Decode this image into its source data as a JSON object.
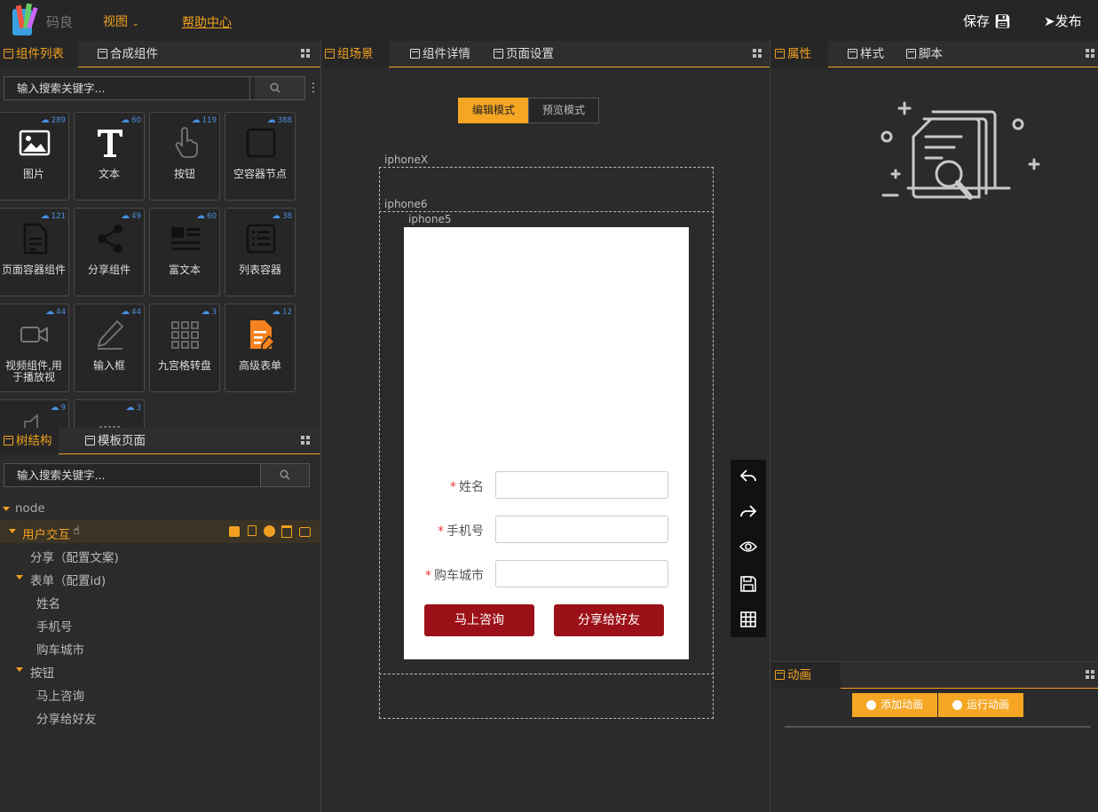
{
  "header": {
    "brand": "码良",
    "menu_view": "视图",
    "menu_help": "帮助中心",
    "save": "保存",
    "publish": "发布"
  },
  "components_panel": {
    "tabs": [
      "组件列表",
      "合成组件"
    ],
    "search_placeholder": "输入搜索关键字...",
    "cards": [
      {
        "label": "图片",
        "count": "289",
        "icon": "image-icon"
      },
      {
        "label": "文本",
        "count": "60",
        "icon": "text-icon"
      },
      {
        "label": "按钮",
        "count": "119",
        "icon": "tap-icon"
      },
      {
        "label": "空容器节点",
        "count": "388",
        "icon": "square-icon"
      },
      {
        "label": "页面容器组件",
        "count": "121",
        "icon": "document-icon"
      },
      {
        "label": "分享组件",
        "count": "49",
        "icon": "share-icon"
      },
      {
        "label": "富文本",
        "count": "60",
        "icon": "richtext-icon"
      },
      {
        "label": "列表容器",
        "count": "38",
        "icon": "list-icon"
      },
      {
        "label": "视频组件,用于播放视",
        "count": "44",
        "icon": "video-icon"
      },
      {
        "label": "输入框",
        "count": "44",
        "icon": "pen-icon"
      },
      {
        "label": "九宫格转盘",
        "count": "3",
        "icon": "grid-icon"
      },
      {
        "label": "高级表单",
        "count": "12",
        "icon": "form-icon"
      },
      {
        "label": "",
        "count": "9",
        "icon": "speaker-icon"
      },
      {
        "label": "",
        "count": "3",
        "icon": "misc-icon"
      }
    ]
  },
  "tree_panel": {
    "tabs": [
      "树结构",
      "模板页面"
    ],
    "search_placeholder": "输入搜索关键字...",
    "nodes": [
      {
        "label": "node",
        "level": 0,
        "caret": true
      },
      {
        "label": "用户交互",
        "level": 1,
        "caret": true,
        "selected": true
      },
      {
        "label": "分享（配置文案)",
        "level": 2,
        "caret": false
      },
      {
        "label": "表单（配置id)",
        "level": 2,
        "caret": true
      },
      {
        "label": "姓名",
        "level": 3,
        "caret": false
      },
      {
        "label": "手机号",
        "level": 3,
        "caret": false
      },
      {
        "label": "购车城市",
        "level": 3,
        "caret": false
      },
      {
        "label": "按钮",
        "level": 2,
        "caret": true
      },
      {
        "label": "马上咨询",
        "level": 3,
        "caret": false
      },
      {
        "label": "分享给好友",
        "level": 3,
        "caret": false
      }
    ]
  },
  "scene_panel": {
    "tabs": [
      "组场景",
      "组件详情",
      "页面设置"
    ],
    "mode_edit": "编辑模式",
    "mode_preview": "预览模式",
    "device_x": "iphoneX",
    "device_6": "iphone6",
    "device_5": "iphone5",
    "form": {
      "fields": [
        "姓名",
        "手机号",
        "购车城市"
      ],
      "required_mark": "*",
      "btn_consult": "马上咨询",
      "btn_share": "分享给好友"
    }
  },
  "props_panel": {
    "tabs": [
      "属性",
      "样式",
      "脚本"
    ]
  },
  "anim_panel": {
    "tab": "动画",
    "add": "添加动画",
    "run": "运行动画"
  },
  "colors": {
    "accent": "#f0a020",
    "button_red": "#9c1118",
    "link_blue": "#4a90e2"
  }
}
